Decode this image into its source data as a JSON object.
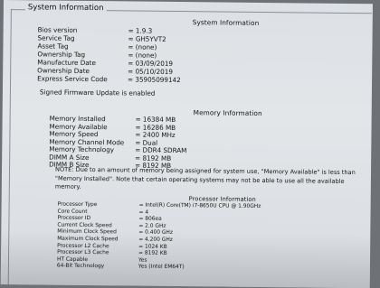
{
  "group_title": "System Information",
  "system": {
    "heading": "System Information",
    "rows": [
      {
        "label": "Bios version",
        "value": "= 1.9.3"
      },
      {
        "label": "Service Tag",
        "value": "= GH5YVT2"
      },
      {
        "label": "Asset Tag",
        "value": "= (none)"
      },
      {
        "label": "Ownership Tag",
        "value": "= (none)"
      },
      {
        "label": "Manufacture Date",
        "value": "= 03/09/2019"
      },
      {
        "label": "Ownership Date",
        "value": "= 05/10/2019"
      },
      {
        "label": "Express Service Code",
        "value": "= 35905099142"
      }
    ],
    "firmware_status": "Signed Firmware Update is enabled"
  },
  "memory": {
    "heading": "Memory Information",
    "rows": [
      {
        "label": "Memory Installed",
        "value": "= 16384 MB"
      },
      {
        "label": "Memory Available",
        "value": "= 16286 MB"
      },
      {
        "label": "Memory Speed",
        "value": "= 2400 MHz"
      },
      {
        "label": "Memory Channel Mode",
        "value": "= Dual"
      },
      {
        "label": "Memory Technology",
        "value": "= DDR4 SDRAM"
      },
      {
        "label": "DIMM A Size",
        "value": "= 8192 MB"
      },
      {
        "label": "DIMM B Size",
        "value": "= 8192 MB"
      }
    ],
    "note": "NOTE: Due to an amount of memory being assigned for system use, \"Memory Available\" is less than \"Memory Installed\". Note that certain operating systems may not be able to use all the available memory."
  },
  "processor": {
    "heading": "Processor Information",
    "rows": [
      {
        "label": "Processor Type",
        "value": "= Intel(R) Core(TM) i7-8650U CPU @ 1.90GHz"
      },
      {
        "label": "Core Count",
        "value": "= 4"
      },
      {
        "label": "Processor ID",
        "value": "= 806ea"
      },
      {
        "label": "Current Clock Speed",
        "value": "= 2.0 GHz"
      },
      {
        "label": "Minimum Clock Speed",
        "value": "= 0.400 GHz"
      },
      {
        "label": "Maximum Clock Speed",
        "value": "= 4.200 GHz"
      },
      {
        "label": "Processor L2 Cache",
        "value": "= 1024 KB"
      },
      {
        "label": "Processor L3 Cache",
        "value": "= 8192 KB"
      },
      {
        "label": "HT Capable",
        "value": "Yes"
      },
      {
        "label": "64-Bit Technology",
        "value": "Yes (Intel EM64T)"
      }
    ]
  }
}
